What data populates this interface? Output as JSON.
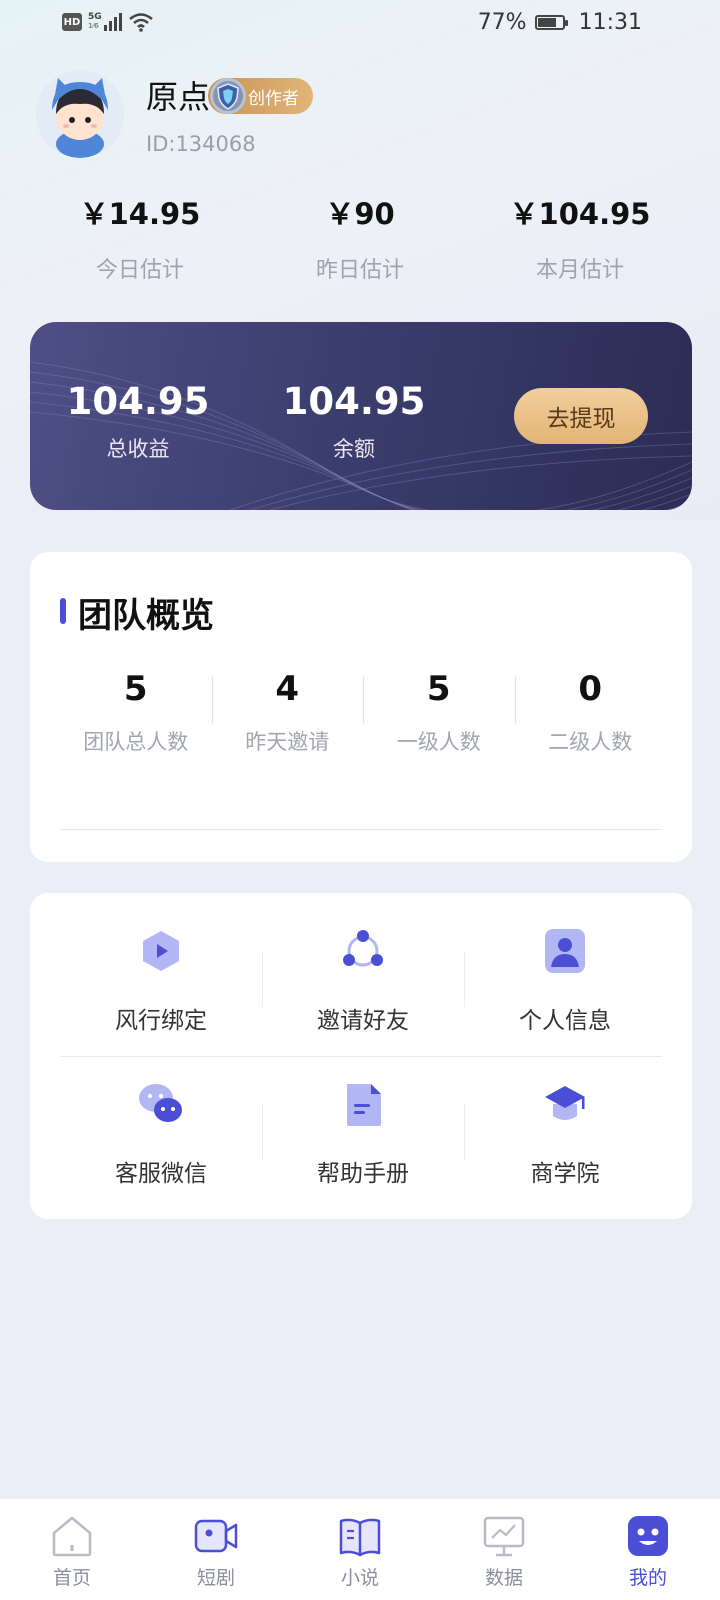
{
  "status_bar": {
    "network_hd": "HD",
    "network_5g": "5G",
    "network_sub": "1⁄6",
    "battery": "77%",
    "battery_level": 0.77,
    "time": "11:31"
  },
  "profile": {
    "name": "原点",
    "badge": "创作者",
    "id": "ID:134068"
  },
  "estimates": [
    {
      "value": "￥14.95",
      "label": "今日估计"
    },
    {
      "value": "￥90",
      "label": "昨日估计"
    },
    {
      "value": "￥104.95",
      "label": "本月估计"
    }
  ],
  "earnings": {
    "total_value": "104.95",
    "total_label": "总收益",
    "balance_value": "104.95",
    "balance_label": "余额",
    "withdraw_label": "去提现"
  },
  "team": {
    "title": "团队概览",
    "stats": [
      {
        "value": "5",
        "label": "团队总人数"
      },
      {
        "value": "4",
        "label": "昨天邀请"
      },
      {
        "value": "5",
        "label": "一级人数"
      },
      {
        "value": "0",
        "label": "二级人数"
      }
    ]
  },
  "menu": [
    {
      "label": "风行绑定",
      "icon": "play-hexagon-icon"
    },
    {
      "label": "邀请好友",
      "icon": "share-nodes-icon"
    },
    {
      "label": "个人信息",
      "icon": "person-card-icon"
    },
    {
      "label": "客服微信",
      "icon": "wechat-icon"
    },
    {
      "label": "帮助手册",
      "icon": "document-icon"
    },
    {
      "label": "商学院",
      "icon": "graduation-cap-icon"
    }
  ],
  "tabs": [
    {
      "label": "首页",
      "icon": "home-icon",
      "active": false
    },
    {
      "label": "短剧",
      "icon": "video-camera-icon",
      "active": false
    },
    {
      "label": "小说",
      "icon": "book-icon",
      "active": false
    },
    {
      "label": "数据",
      "icon": "chart-board-icon",
      "active": false
    },
    {
      "label": "我的",
      "icon": "smiley-face-icon",
      "active": true
    }
  ],
  "colors": {
    "accent": "#4a4fd6",
    "icon_light": "#a9acf2",
    "card_dark": "#3a3c6c",
    "gold": "#e3b477"
  }
}
